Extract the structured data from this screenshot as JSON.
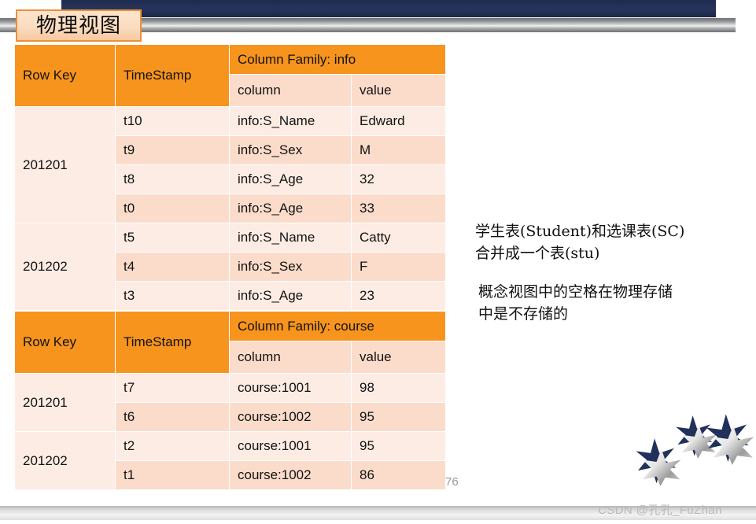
{
  "slide": {
    "title": "物理视图",
    "page_number": "76",
    "watermark": "CSDN @孔孔_FuZhan"
  },
  "colors": {
    "header_orange": "#F7941E",
    "row_light": "#FDECE4",
    "row_dark": "#FBDCCB",
    "navy_bar": "#232F54",
    "title_border": "#EF8F36"
  },
  "tables": [
    {
      "id": "info",
      "headers": {
        "row_key": "Row Key",
        "timestamp": "TimeStamp",
        "column_family": "Column Family: info",
        "sub_column": "column",
        "sub_value": "value"
      },
      "rows": [
        {
          "row_key": "201201",
          "timestamp": "t10",
          "column": "info:S_Name",
          "value": "Edward"
        },
        {
          "row_key": "",
          "timestamp": "t9",
          "column": "info:S_Sex",
          "value": "M"
        },
        {
          "row_key": "",
          "timestamp": "t8",
          "column": "info:S_Age",
          "value": "32"
        },
        {
          "row_key": "",
          "timestamp": "t0",
          "column": "info:S_Age",
          "value": "33"
        },
        {
          "row_key": "201202",
          "timestamp": "t5",
          "column": "info:S_Name",
          "value": "Catty"
        },
        {
          "row_key": "",
          "timestamp": "t4",
          "column": "info:S_Sex",
          "value": "F"
        },
        {
          "row_key": "",
          "timestamp": "t3",
          "column": "info:S_Age",
          "value": "23"
        }
      ],
      "row_key_groups": [
        {
          "label": "201201",
          "span": 4
        },
        {
          "label": "201202",
          "span": 3
        }
      ]
    },
    {
      "id": "course",
      "headers": {
        "row_key": "Row Key",
        "timestamp": "TimeStamp",
        "column_family": "Column Family: course",
        "sub_column": "column",
        "sub_value": "value"
      },
      "rows": [
        {
          "row_key": "201201",
          "timestamp": "t7",
          "column": "course:1001",
          "value": "98"
        },
        {
          "row_key": "",
          "timestamp": "t6",
          "column": "course:1002",
          "value": "95"
        },
        {
          "row_key": "201202",
          "timestamp": "t2",
          "column": "course:1001",
          "value": "95"
        },
        {
          "row_key": "",
          "timestamp": "t1",
          "column": "course:1002",
          "value": "86"
        }
      ],
      "row_key_groups": [
        {
          "label": "201201",
          "span": 2
        },
        {
          "label": "201202",
          "span": 2
        }
      ]
    }
  ],
  "notes": {
    "note_1": "学生表(Student)和选课表(SC)\n合并成一个表(stu)",
    "note_2": " 概念视图中的空格在物理存储\n中是不存储的"
  }
}
